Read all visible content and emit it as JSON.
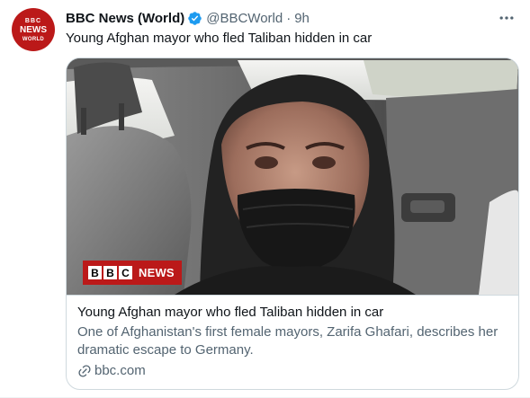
{
  "account": {
    "avatar_line1": "BBC",
    "avatar_line2": "NEWS",
    "avatar_line3": "WORLD",
    "display_name": "BBC News (World)",
    "handle": "@BBCWorld",
    "separator": "·",
    "time": "9h",
    "verified_color": "#1d9bf0",
    "brand_color": "#bb1919"
  },
  "tweet": {
    "text": "Young Afghan mayor who fled Taliban hidden in car"
  },
  "card": {
    "badge_letters": [
      "B",
      "B",
      "C"
    ],
    "badge_word": "NEWS",
    "title": "Young Afghan mayor who fled Taliban hidden in car",
    "description": "One of Afghanistan's first female mayors, Zarifa Ghafari, describes her dramatic escape to Germany.",
    "domain": "bbc.com"
  },
  "icons": {
    "more": "more-options-icon",
    "verified": "verified-badge-icon",
    "link": "link-icon"
  }
}
